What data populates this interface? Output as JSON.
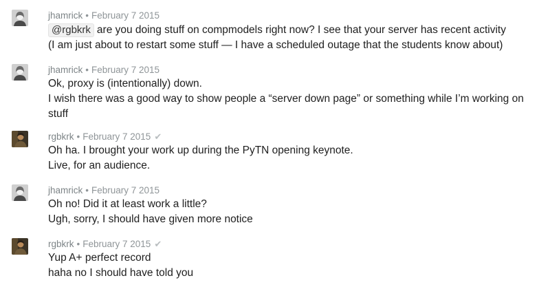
{
  "messages": [
    {
      "author": "jhamrick",
      "separator": "•",
      "date": "February 7 2015",
      "avatar_icon": "user-photo-icon",
      "mention": "@rgbkrk",
      "lines": [
        "are you doing stuff on compmodels right now? I see that your server has recent activity",
        "(I am just about to restart some stuff — I have a scheduled outage that the students know about)"
      ]
    },
    {
      "author": "jhamrick",
      "separator": "•",
      "date": "February 7 2015",
      "avatar_icon": "user-photo-icon",
      "lines": [
        "Ok, proxy is (intentionally) down.",
        "I wish there was a good way to show people a “server down page” or something while I’m working on stuff"
      ]
    },
    {
      "author": "rgbkrk",
      "separator": "•",
      "date": "February 7 2015",
      "avatar_icon": "user-photo-icon",
      "read_icon": "checkmark-icon",
      "read_glyph": "✔",
      "lines": [
        "Oh ha. I brought your work up during the PyTN opening keynote.",
        "Live, for an audience."
      ]
    },
    {
      "author": "jhamrick",
      "separator": "•",
      "date": "February 7 2015",
      "avatar_icon": "user-photo-icon",
      "lines": [
        "Oh no! Did it at least work a little?",
        "Ugh, sorry, I should have given more notice"
      ]
    },
    {
      "author": "rgbkrk",
      "separator": "•",
      "date": "February 7 2015",
      "avatar_icon": "user-photo-icon",
      "read_icon": "checkmark-icon",
      "read_glyph": "✔",
      "lines": [
        "Yup A+ perfect record",
        "haha no I should have told you"
      ]
    }
  ]
}
